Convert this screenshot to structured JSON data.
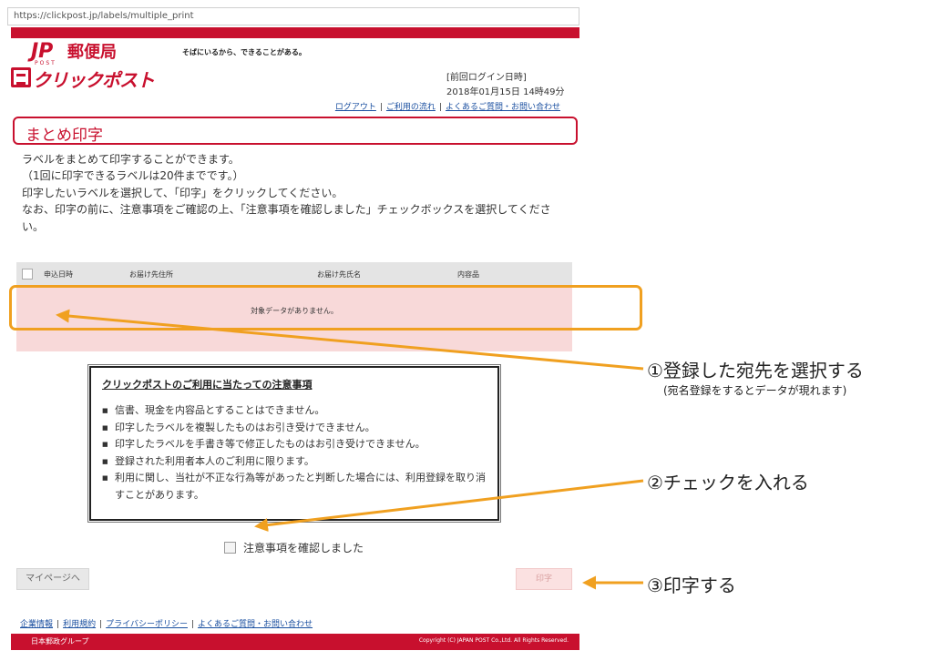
{
  "browser": {
    "url": "https://clickpost.jp/labels/multiple_print"
  },
  "header": {
    "logo_jp": "JP",
    "logo_post": "POST",
    "logo_yubinkyoku": "郵便局",
    "tagline": "そばにいるから、できることがある。",
    "service_logo": "クリックポスト",
    "last_login_label": "[前回ログイン日時]",
    "last_login_value": "2018年01月15日 14時49分",
    "links": [
      "ログアウト",
      "ご利用の流れ",
      "よくあるご質問・お問い合わせ"
    ]
  },
  "page_title": "まとめ印字",
  "description": [
    "ラベルをまとめて印字することができます。",
    "（1回に印字できるラベルは20件までです。）",
    "印字したいラベルを選択して、「印字」をクリックしてください。",
    "なお、印字の前に、注意事項をご確認の上、「注意事項を確認しました」チェックボックスを選択してください。"
  ],
  "table": {
    "columns": [
      "申込日時",
      "お届け先住所",
      "お届け先氏名",
      "内容品"
    ],
    "empty_message": "対象データがありません。"
  },
  "notice": {
    "title": "クリックポストのご利用に当たっての注意事項",
    "items": [
      "信書、現金を内容品とすることはできません。",
      "印字したラベルを複製したものはお引き受けできません。",
      "印字したラベルを手書き等で修正したものはお引き受けできません。",
      "登録された利用者本人のご利用に限ります。",
      "利用に関し、当社が不正な行為等があったと判断した場合には、利用登録を取り消すことがあります。"
    ]
  },
  "confirm_label": "注意事項を確認しました",
  "buttons": {
    "mypage": "マイページへ",
    "print": "印字"
  },
  "footer": {
    "links": [
      "企業情報",
      "利用規約",
      "プライバシーポリシー",
      "よくあるご質問・お問い合わせ"
    ],
    "group": "日本郵政グループ",
    "copyright": "Copyright (C) JAPAN POST Co.,Ltd. All Rights Reserved."
  },
  "annotations": {
    "step1": "①登録した宛先を選択する",
    "step1_sub": "(宛名登録をするとデータが現れます)",
    "step2": "②チェックを入れる",
    "step3": "③印字する",
    "arrow_color": "#f0a020"
  },
  "colors": {
    "brand_red": "#c8102e",
    "empty_row_bg": "#f8d9d9",
    "link_blue": "#1a4fa0"
  }
}
